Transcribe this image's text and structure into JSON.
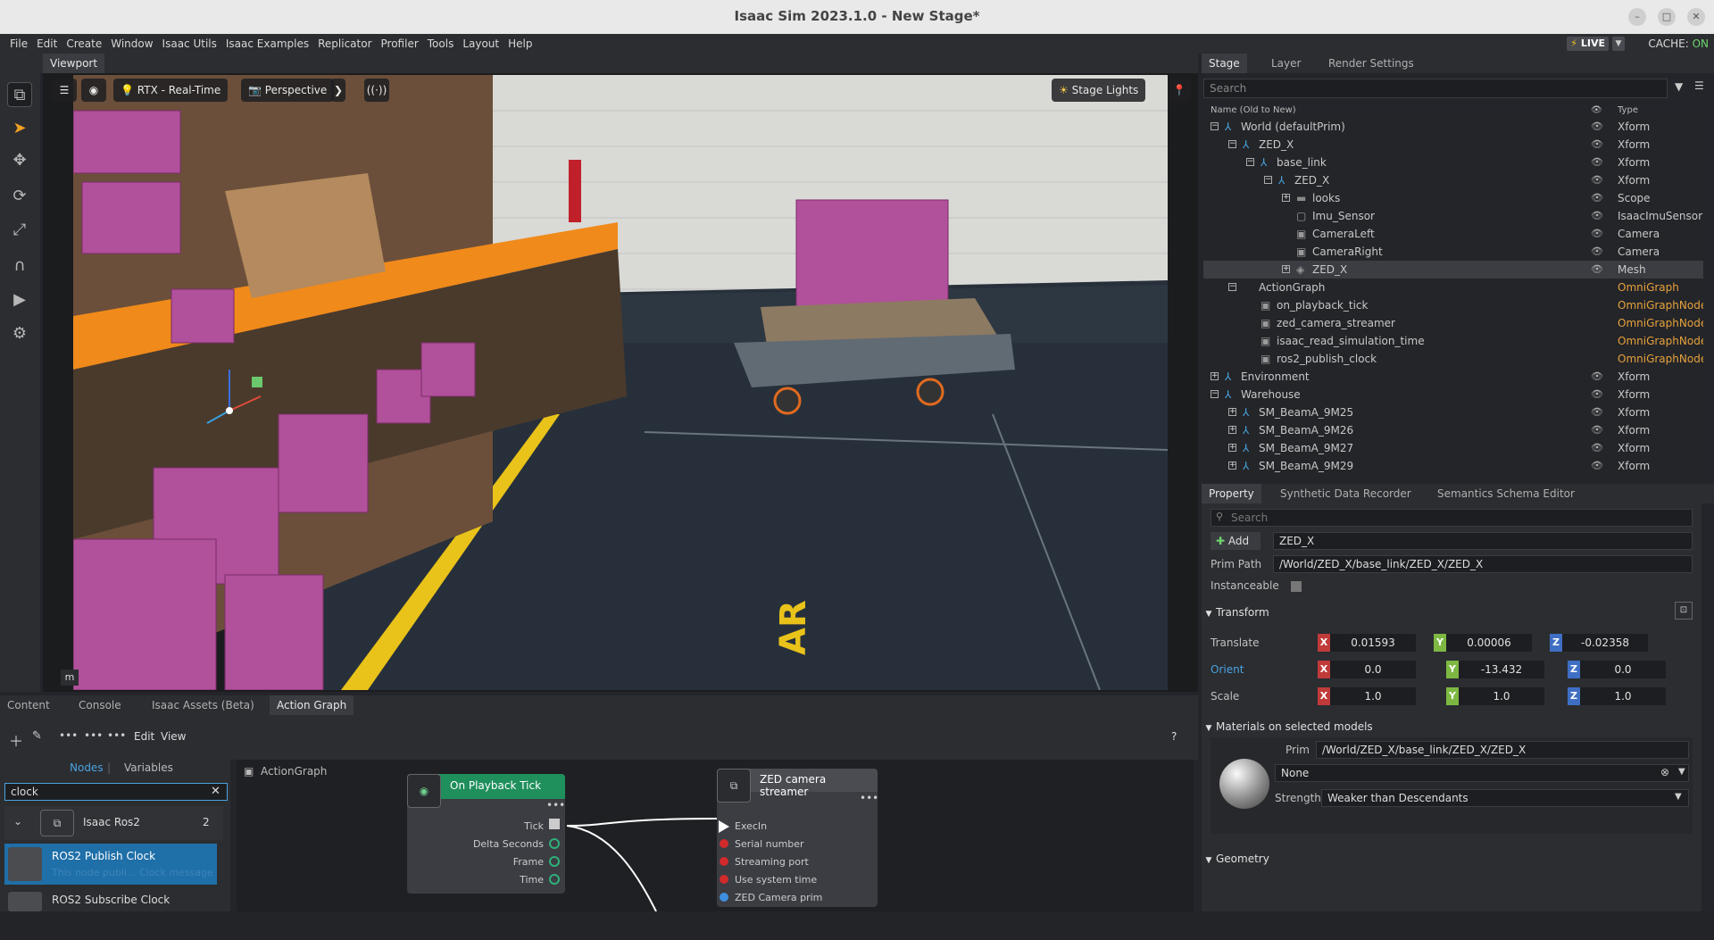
{
  "window": {
    "title": "Isaac Sim 2023.1.0 - New Stage*"
  },
  "menu": {
    "items": [
      "File",
      "Edit",
      "Create",
      "Window",
      "Isaac Utils",
      "Isaac Examples",
      "Replicator",
      "Profiler",
      "Tools",
      "Layout",
      "Help"
    ],
    "live": "LIVE",
    "cache_label": "CACHE:",
    "cache_state": "ON"
  },
  "viewport": {
    "tab": "Viewport",
    "renderer": "RTX - Real-Time",
    "camera": "Perspective",
    "lights": "Stage Lights",
    "units": "m"
  },
  "bottom_tabs": [
    "Content",
    "Console",
    "Isaac Assets (Beta)",
    "Action Graph"
  ],
  "action_graph": {
    "edit": "Edit",
    "view": "View",
    "help": "?",
    "nodes_tab": "Nodes",
    "variables_tab": "Variables",
    "search_value": "clock",
    "category": "Isaac Ros2",
    "category_count": "2",
    "items": [
      {
        "title": "ROS2 Publish Clock",
        "desc": "This node publi... Clock message"
      },
      {
        "title": "ROS2 Subscribe Clock",
        "desc": ""
      }
    ],
    "breadcrumb": "ActionGraph",
    "node_tick": {
      "title": "On Playback Tick",
      "ports": [
        "Tick",
        "Delta Seconds",
        "Frame",
        "Time"
      ]
    },
    "node_zed": {
      "title": "ZED camera streamer",
      "ports": [
        "ExecIn",
        "Serial number",
        "Streaming port",
        "Use system time",
        "ZED Camera prim"
      ]
    }
  },
  "stage": {
    "tabs": [
      "Stage",
      "Layer",
      "Render Settings"
    ],
    "search_placeholder": "Search",
    "col_name": "Name (Old to New)",
    "col_type": "Type",
    "rows": [
      {
        "name": "World (defaultPrim)",
        "type": "Xform"
      },
      {
        "name": "ZED_X",
        "type": "Xform"
      },
      {
        "name": "base_link",
        "type": "Xform"
      },
      {
        "name": "ZED_X",
        "type": "Xform"
      },
      {
        "name": "looks",
        "type": "Scope"
      },
      {
        "name": "Imu_Sensor",
        "type": "IsaacImuSensor"
      },
      {
        "name": "CameraLeft",
        "type": "Camera"
      },
      {
        "name": "CameraRight",
        "type": "Camera"
      },
      {
        "name": "ZED_X",
        "type": "Mesh"
      },
      {
        "name": "ActionGraph",
        "type": "OmniGraph"
      },
      {
        "name": "on_playback_tick",
        "type": "OmniGraphNode"
      },
      {
        "name": "zed_camera_streamer",
        "type": "OmniGraphNode"
      },
      {
        "name": "isaac_read_simulation_time",
        "type": "OmniGraphNode"
      },
      {
        "name": "ros2_publish_clock",
        "type": "OmniGraphNode"
      },
      {
        "name": "Environment",
        "type": "Xform"
      },
      {
        "name": "Warehouse",
        "type": "Xform"
      },
      {
        "name": "SM_BeamA_9M25",
        "type": "Xform"
      },
      {
        "name": "SM_BeamA_9M26",
        "type": "Xform"
      },
      {
        "name": "SM_BeamA_9M27",
        "type": "Xform"
      },
      {
        "name": "SM_BeamA_9M29",
        "type": "Xform"
      }
    ]
  },
  "property": {
    "tabs": [
      "Property",
      "Synthetic Data Recorder",
      "Semantics Schema Editor"
    ],
    "search_placeholder": "Search",
    "add_label": "Add",
    "prim_name": "ZED_X",
    "prim_path_label": "Prim Path",
    "prim_path": "/World/ZED_X/base_link/ZED_X/ZED_X",
    "instanceable_label": "Instanceable",
    "transform_label": "Transform",
    "translate_label": "Translate",
    "translate": [
      "0.01593",
      "0.00006",
      "-0.02358"
    ],
    "orient_label": "Orient",
    "orient": [
      "0.0",
      "-13.432",
      "0.0"
    ],
    "scale_label": "Scale",
    "scale": [
      "1.0",
      "1.0",
      "1.0"
    ],
    "materials_label": "Materials on selected models",
    "mat_prim_label": "Prim",
    "mat_prim": "/World/ZED_X/base_link/ZED_X/ZED_X",
    "material": "None",
    "strength_label": "Strength",
    "strength": "Weaker than Descendants",
    "geometry_label": "Geometry"
  }
}
